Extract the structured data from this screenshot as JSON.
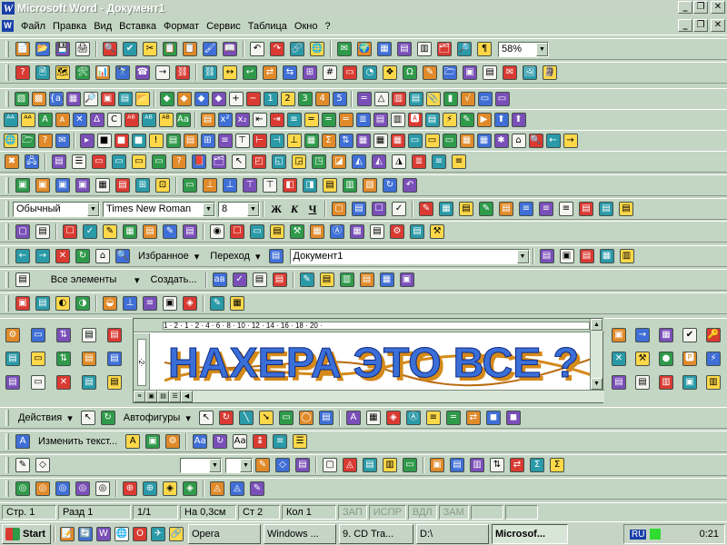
{
  "window": {
    "title": "Microsoft Word - Документ1",
    "app_icon": "W",
    "controls": [
      "_",
      "❐",
      "✕"
    ]
  },
  "menu": {
    "items": [
      "Файл",
      "Правка",
      "Вид",
      "Вставка",
      "Формат",
      "Сервис",
      "Таблица",
      "Окно",
      "?"
    ]
  },
  "icons": {
    "rows": [
      [
        "📄",
        "📂",
        "💾",
        "🖨",
        "🔍",
        "✔",
        "✂",
        "📋",
        "📋",
        "🖌",
        "📖",
        "↶",
        "↷",
        "🔗",
        "🌐",
        "✉",
        "🌍",
        "▦",
        "▤",
        "▥",
        "🗂",
        "🔎",
        "¶"
      ],
      [
        "?",
        "🗎",
        "🗺",
        "🛠",
        "📊",
        "🔭",
        "☎",
        "→",
        "⛓",
        "⛓",
        "↔",
        "↩",
        "⇄",
        "⇆",
        "⊞",
        "#",
        "▭",
        "◔",
        "❖",
        "Ω",
        "✎",
        "🗁",
        "▣",
        "▤",
        "✉",
        "🖼",
        "🗿"
      ],
      [
        "▧",
        "▩",
        "{a}",
        "▦",
        "🔎",
        "▣",
        "▤",
        "📂",
        "◆",
        "◆",
        "◆",
        "◆",
        "+",
        "−",
        "1",
        "2",
        "3",
        "4",
        "5",
        "═",
        "△",
        "▥",
        "▤",
        "📎",
        "▮",
        "√",
        "▭",
        "▭"
      ],
      [
        "ᴬᴬ",
        "ᴬᴬ",
        "A",
        "ᴀ",
        "✕",
        "Δ",
        "C",
        "ᴬᴮ",
        "ᴬᴮ",
        "ᴬᴮ",
        "Aa",
        "▤",
        "x²",
        "x₂",
        "⇤",
        "⇥",
        "≡",
        "═",
        "═",
        "═",
        "≣",
        "▤",
        "▥",
        "🅰",
        "▤",
        "⚡",
        "✎",
        "▶",
        "⬆",
        "⬆"
      ],
      [
        "🌐",
        "🗁",
        "?",
        "✉",
        "▸",
        "■",
        "■",
        "■",
        "!",
        "▤",
        "▤",
        "⊞",
        "≡",
        "⊤",
        "⊢",
        "⊣",
        "⊥",
        "▦",
        "Σ",
        "⇅",
        "▦",
        "▦",
        "▦",
        "▭",
        "▭",
        "▭",
        "▦",
        "▦",
        "✱",
        "⌂",
        "🔍",
        "←",
        "→"
      ],
      [
        "✖",
        "🖧",
        "▤",
        "☰",
        "▭",
        "▭",
        "▭",
        "▭",
        "?",
        "📕",
        "🗂",
        "↖",
        "◰",
        "◱",
        "◲",
        "◳",
        "◪",
        "◭",
        "◭",
        "◮",
        "≣",
        "≡",
        "≡"
      ],
      [
        "▣",
        "▣",
        "▣",
        "▣",
        "▦",
        "▤",
        "⊞",
        "⊡",
        "▭",
        "⊥",
        "⊥",
        "⊤",
        "⊤",
        "◧",
        "◨",
        "▤",
        "▥",
        "▧",
        "↻",
        "↶"
      ]
    ],
    "misc": {
      "format_extras": [
        "▢",
        "▤",
        "☐",
        "✓",
        "✎",
        "▦",
        "▤",
        "✎",
        "▤"
      ],
      "right_palette": [
        "▣",
        "→",
        "▦",
        "✔",
        "🔑",
        "✕",
        "⚒",
        "●",
        "🅿",
        "⚡",
        "▤",
        "▤",
        "▥",
        "▣",
        "▥"
      ],
      "left_palette": [
        "⚙",
        "▭",
        "⇅",
        "▤",
        "▤",
        "▤",
        "▭",
        "⇅",
        "▤",
        "▤",
        "▤",
        "▭",
        "✕",
        "▤",
        "▤"
      ],
      "drawing": [
        "↖",
        "↻",
        "╲",
        "➘",
        "▭",
        "◯",
        "▤",
        "A",
        "▦",
        "◈",
        "Ⓐ",
        "≡",
        "═",
        "⇄",
        "◼",
        "◼"
      ],
      "wordart_tb": [
        "A",
        "▣",
        "⚙",
        "Aa",
        "↻",
        "Aa",
        "↨",
        "≡",
        "☰"
      ],
      "outline": [
        "✎",
        "◇",
        "▤",
        "▢",
        "◬",
        "▤",
        "▥",
        "▭",
        "▣",
        "▤",
        "▥",
        "⇅",
        "⇄",
        "Σ",
        "Σ"
      ],
      "shadow": [
        "◎",
        "◎",
        "◎",
        "◎",
        "◎",
        "⊕",
        "⊕",
        "◈",
        "◈",
        "◬",
        "◬",
        "✎"
      ],
      "taskbar_ql": [
        "📝",
        "🔄",
        "W",
        "🌐",
        "O",
        "✈",
        "🔗"
      ]
    }
  },
  "format_toolbar": {
    "style": "Обычный",
    "font": "Times New Roman",
    "size": "8",
    "bold": "Ж",
    "italic": "К",
    "underline": "Ч"
  },
  "web_toolbar": {
    "favorites": "Избранное",
    "go": "Переход",
    "address": "Документ1"
  },
  "autotext_toolbar": {
    "all_items": "Все элементы",
    "create": "Создать..."
  },
  "zoom": "58%",
  "ruler": {
    "marks": "1 · 2 · 1 · 2 · 4 · 6 · 8 · 10 · 12 · 14 · 16 · 18 · 20 ·"
  },
  "wordart": {
    "text": "НАХЕРА ЭТО ВСЕ ?"
  },
  "drawing_toolbar": {
    "actions": "Действия",
    "autoshapes": "Автофигуры"
  },
  "wordart_toolbar": {
    "edit_text": "Изменить текст..."
  },
  "statusbar": {
    "page": "Стр. 1",
    "section": "Разд 1",
    "pages": "1/1",
    "at": "На 0,3см",
    "line": "Ст 2",
    "col": "Кол 1",
    "flags": [
      "ЗАП",
      "ИСПР",
      "ВДЛ",
      "ЗАМ"
    ]
  },
  "taskbar": {
    "start": "Start",
    "tasks": [
      "Opera",
      "Windows ...",
      "9. CD Tra...",
      "D:\\",
      "Microsof..."
    ],
    "lang": "RU",
    "clock": "0:21"
  },
  "colors": {
    "bg": "#c3d5c3",
    "accent": "#1a3fa8",
    "wordart_fill": "#3b6fd8",
    "wordart_shadow": "#d48a1a"
  }
}
